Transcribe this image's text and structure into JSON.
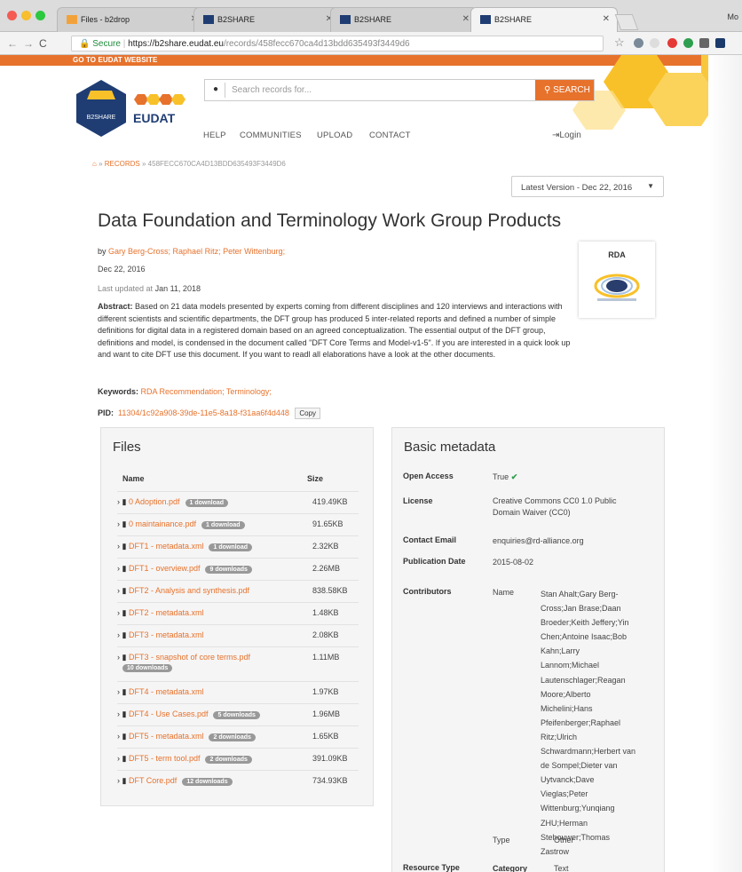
{
  "browser": {
    "tabs": [
      {
        "label": "Files - b2drop",
        "active": false
      },
      {
        "label": "B2SHARE",
        "active": false
      },
      {
        "label": "B2SHARE",
        "active": false
      },
      {
        "label": "B2SHARE",
        "active": true
      }
    ],
    "profile": "Mo",
    "secure_label": "Secure",
    "url_host": "https://b2share.eudat.eu",
    "url_path": "/records/458fecc670ca4d13bdd635493f3449d6"
  },
  "topbar": {
    "go_to_eudat": "GO TO EUDAT WEBSITE"
  },
  "logos": {
    "b2share": "B2SHARE",
    "eudat": "EUDAT"
  },
  "search": {
    "placeholder": "Search records for...",
    "button": "SEARCH"
  },
  "menu": {
    "help": "HELP",
    "communities": "COMMUNITIES",
    "upload": "UPLOAD",
    "contact": "CONTACT",
    "login": "Login"
  },
  "breadcrumb": {
    "records": "RECORDS",
    "id": "458FECC670CA4D13BDD635493F3449D6"
  },
  "version": {
    "label": "Latest Version - Dec 22, 2016"
  },
  "record": {
    "title": "Data Foundation and Terminology Work Group Products",
    "by": "by",
    "authors": "Gary Berg-Cross; Raphael Ritz; Peter Wittenburg;",
    "date": "Dec 22, 2016",
    "updated_prefix": "Last updated at",
    "updated": "Jan 11, 2018",
    "abstract_label": "Abstract:",
    "abstract": "Based on 21 data models presented by experts coming from different disciplines and 120 interviews and interactions with different scientists and scientific departments, the DFT group has produced 5 inter-related reports and defined a number of simple definitions for digital data in a registered domain based on an agreed conceptualization. The essential output of the DFT group, definitions and model, is condensed in the document called \"DFT Core Terms and Model-v1-5\". If you are interested in a quick look up and want to cite DFT use this document. If you want to readl all elaborations have a look at the other documents.",
    "keywords_label": "Keywords:",
    "keywords": "RDA Recommendation; Terminology;",
    "pid_label": "PID:",
    "pid": "11304/1c92a908-39de-11e5-8a18-f31aa6f4d448",
    "copy": "Copy",
    "community": "RDA"
  },
  "files": {
    "title": "Files",
    "col_name": "Name",
    "col_size": "Size",
    "rows": [
      {
        "name": "0 Adoption.pdf",
        "badge": "1 download",
        "size": "419.49KB"
      },
      {
        "name": "0 maintainance.pdf",
        "badge": "1 download",
        "size": "91.65KB"
      },
      {
        "name": "DFT1 - metadata.xml",
        "badge": "1 download",
        "size": "2.32KB"
      },
      {
        "name": "DFT1 - overview.pdf",
        "badge": "9 downloads",
        "size": "2.26MB"
      },
      {
        "name": "DFT2 - Analysis and synthesis.pdf",
        "badge": "",
        "size": "838.58KB"
      },
      {
        "name": "DFT2 - metadata.xml",
        "badge": "",
        "size": "1.48KB"
      },
      {
        "name": "DFT3 - metadata.xml",
        "badge": "",
        "size": "2.08KB"
      },
      {
        "name": "DFT3 - snapshot of core terms.pdf",
        "badge": "10 downloads",
        "size": "1.11MB"
      },
      {
        "name": "DFT4 - metadata.xml",
        "badge": "",
        "size": "1.97KB"
      },
      {
        "name": "DFT4 - Use Cases.pdf",
        "badge": "5 downloads",
        "size": "1.96MB"
      },
      {
        "name": "DFT5 - metadata.xml",
        "badge": "2 downloads",
        "size": "1.65KB"
      },
      {
        "name": "DFT5 - term tool.pdf",
        "badge": "2 downloads",
        "size": "391.09KB"
      },
      {
        "name": "DFT Core.pdf",
        "badge": "12 downloads",
        "size": "734.93KB"
      }
    ]
  },
  "metadata": {
    "title": "Basic metadata",
    "open_access_label": "Open Access",
    "open_access": "True",
    "license_label": "License",
    "license": "Creative Commons CC0 1.0 Public Domain Waiver (CC0)",
    "email_label": "Contact Email",
    "email": "enquiries@rd-alliance.org",
    "pubdate_label": "Publication Date",
    "pubdate": "2015-08-02",
    "contributors_label": "Contributors",
    "name_label": "Name",
    "contributors": "Stan Ahalt;Gary Berg-Cross;Jan Brase;Daan Broeder;Keith Jeffery;Yin Chen;Antoine Isaac;Bob Kahn;Larry Lannom;Michael Lautenschlager;Reagan Moore;Alberto Michelini;Hans Pfeifenberger;Raphael Ritz;Ulrich Schwardmann;Herbert van de Sompel;Dieter van Uytvanck;Dave Vieglas;Peter Wittenburg;Yunqiang ZHU;Herman Stehouwer;Thomas Zastrow",
    "type_label": "Type",
    "type": "Other",
    "resource_type_label": "Resource Type",
    "category_label": "Category",
    "category": "Text"
  },
  "colors": {
    "accent": "#e7722c",
    "logo_blue": "#1f3d73",
    "yellow": "#f8c12a"
  }
}
